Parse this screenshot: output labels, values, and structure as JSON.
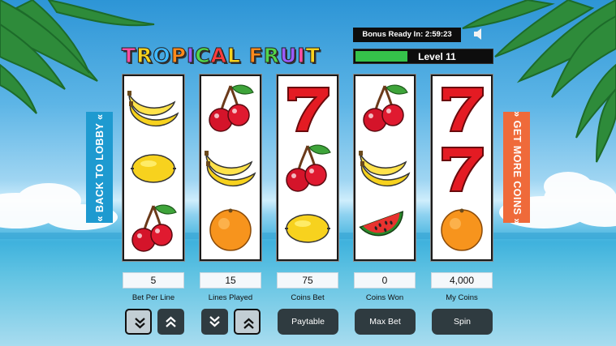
{
  "title": {
    "text": "TROPICAL FRUIT"
  },
  "bonus": {
    "text": "Bonus Ready In: 2:59:23"
  },
  "level": {
    "label": "Level 11",
    "progress": 0.38
  },
  "side_buttons": {
    "back_to_lobby": "BACK TO LOBBY",
    "get_more_coins": "GET MORE COINS"
  },
  "reels": [
    [
      "banana",
      "lemon",
      "cherry"
    ],
    [
      "cherry",
      "banana",
      "orange"
    ],
    [
      "seven",
      "cherry",
      "lemon"
    ],
    [
      "cherry",
      "banana",
      "watermelon"
    ],
    [
      "seven",
      "seven",
      "orange"
    ]
  ],
  "stats": {
    "bet_per_line": {
      "value": "5",
      "label": "Bet Per Line"
    },
    "lines_played": {
      "value": "15",
      "label": "Lines Played"
    },
    "coins_bet": {
      "value": "75",
      "label": "Coins Bet"
    },
    "coins_won": {
      "value": "0",
      "label": "Coins Won"
    },
    "my_coins": {
      "value": "4,000",
      "label": "My Coins"
    }
  },
  "buttons": {
    "paytable": "Paytable",
    "max_bet": "Max Bet",
    "spin": "Spin"
  },
  "colors": {
    "lobby_button": "#1e9ad0",
    "coins_button": "#ef6a3a",
    "level_fill": "#35c24a"
  }
}
